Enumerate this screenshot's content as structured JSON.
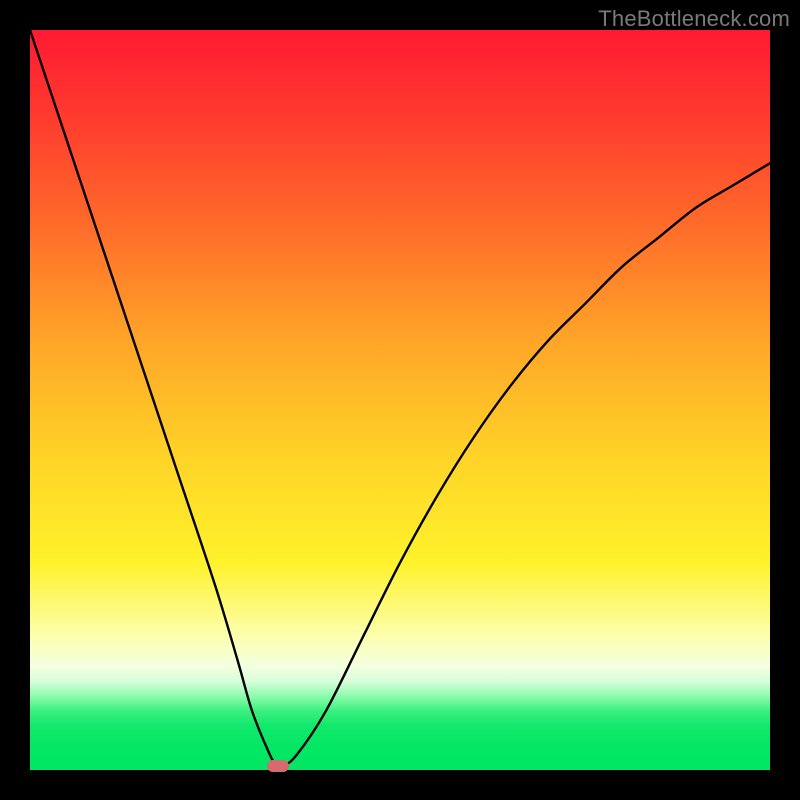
{
  "watermark": "TheBottleneck.com",
  "chart_data": {
    "type": "line",
    "title": "",
    "xlabel": "",
    "ylabel": "",
    "xlim": [
      0,
      100
    ],
    "ylim": [
      0,
      100
    ],
    "grid": false,
    "legend": false,
    "series": [
      {
        "name": "bottleneck-curve",
        "x": [
          0,
          5,
          10,
          15,
          20,
          25,
          28,
          30,
          32,
          33,
          34,
          36,
          40,
          45,
          50,
          55,
          60,
          65,
          70,
          75,
          80,
          85,
          90,
          95,
          100
        ],
        "y": [
          100,
          85,
          70,
          55,
          40,
          25,
          15,
          8,
          3,
          1,
          0.5,
          2,
          8,
          18,
          28,
          37,
          45,
          52,
          58,
          63,
          68,
          72,
          76,
          79,
          82
        ]
      }
    ],
    "marker": {
      "x": 33.5,
      "y": 0.5,
      "name": "minimum-point"
    },
    "background_gradient": {
      "top": "#ff1a33",
      "mid": "#ffd427",
      "bottom": "#02e763"
    }
  }
}
